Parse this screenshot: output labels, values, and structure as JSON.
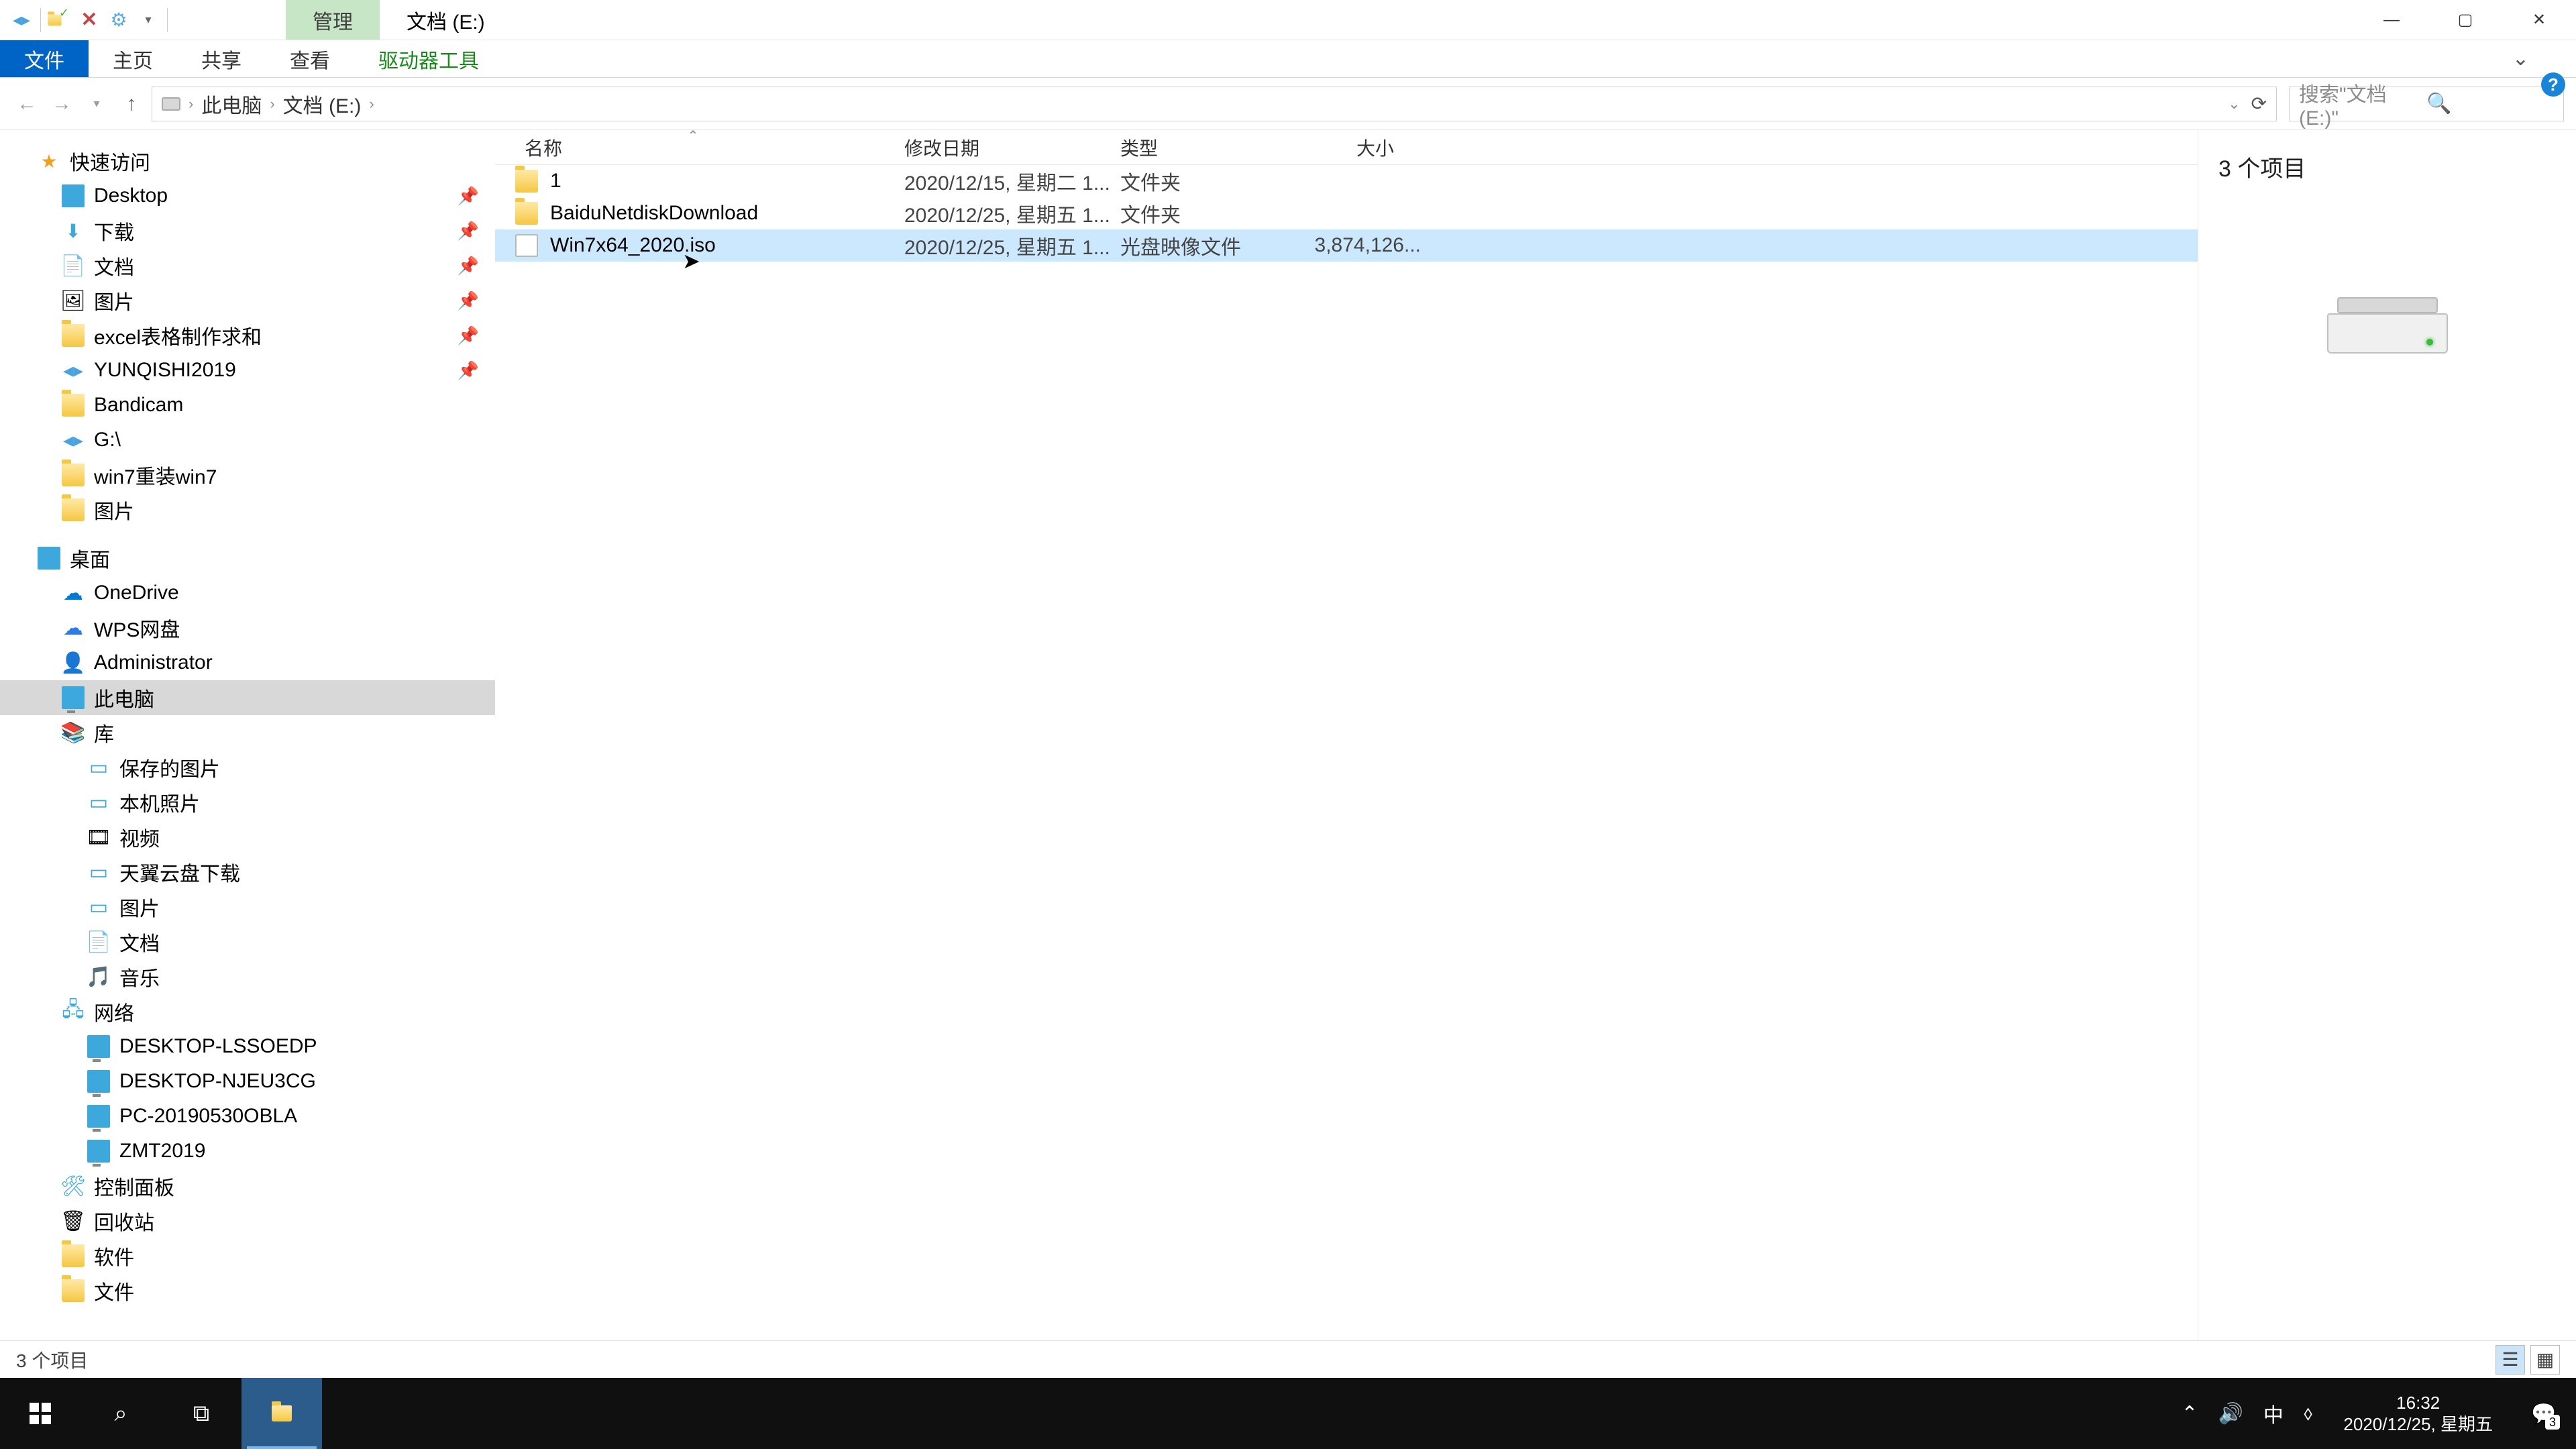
{
  "titlebar": {
    "context_tab": "管理",
    "window_title": "文档 (E:)"
  },
  "ribbon": {
    "file": "文件",
    "home": "主页",
    "share": "共享",
    "view": "查看",
    "drive_tools": "驱动器工具"
  },
  "address": {
    "crumb_pc": "此电脑",
    "crumb_drive": "文档 (E:)"
  },
  "search": {
    "placeholder": "搜索\"文档 (E:)\""
  },
  "columns": {
    "name": "名称",
    "date": "修改日期",
    "type": "类型",
    "size": "大小"
  },
  "files": [
    {
      "name": "1",
      "date": "2020/12/15, 星期二 1...",
      "type": "文件夹",
      "size": "",
      "kind": "folder",
      "selected": false
    },
    {
      "name": "BaiduNetdiskDownload",
      "date": "2020/12/25, 星期五 1...",
      "type": "文件夹",
      "size": "",
      "kind": "folder",
      "selected": false
    },
    {
      "name": "Win7x64_2020.iso",
      "date": "2020/12/25, 星期五 1...",
      "type": "光盘映像文件",
      "size": "3,874,126...",
      "kind": "file",
      "selected": true
    }
  ],
  "preview": {
    "count_label": "3 个项目"
  },
  "status": {
    "items_label": "3 个项目"
  },
  "tree": {
    "quick_access": "快速访问",
    "desktop": "Desktop",
    "downloads": "下载",
    "documents": "文档",
    "pictures": "图片",
    "excel": "excel表格制作求和",
    "yunqishi": "YUNQISHI2019",
    "bandicam": "Bandicam",
    "g_drive": "G:\\",
    "win7reinstall": "win7重装win7",
    "pictures2": "图片",
    "desktop_cn": "桌面",
    "onedrive": "OneDrive",
    "wps": "WPS网盘",
    "admin": "Administrator",
    "this_pc": "此电脑",
    "library": "库",
    "saved_pics": "保存的图片",
    "camera_roll": "本机照片",
    "videos": "视频",
    "tianyi": "天翼云盘下载",
    "lib_pics": "图片",
    "lib_docs": "文档",
    "music": "音乐",
    "network": "网络",
    "net1": "DESKTOP-LSSOEDP",
    "net2": "DESKTOP-NJEU3CG",
    "net3": "PC-20190530OBLA",
    "net4": "ZMT2019",
    "control_panel": "控制面板",
    "recycle": "回收站",
    "software": "软件",
    "files_folder": "文件"
  },
  "taskbar": {
    "time": "16:32",
    "date": "2020/12/25, 星期五",
    "ime": "中",
    "notif_count": "3"
  }
}
